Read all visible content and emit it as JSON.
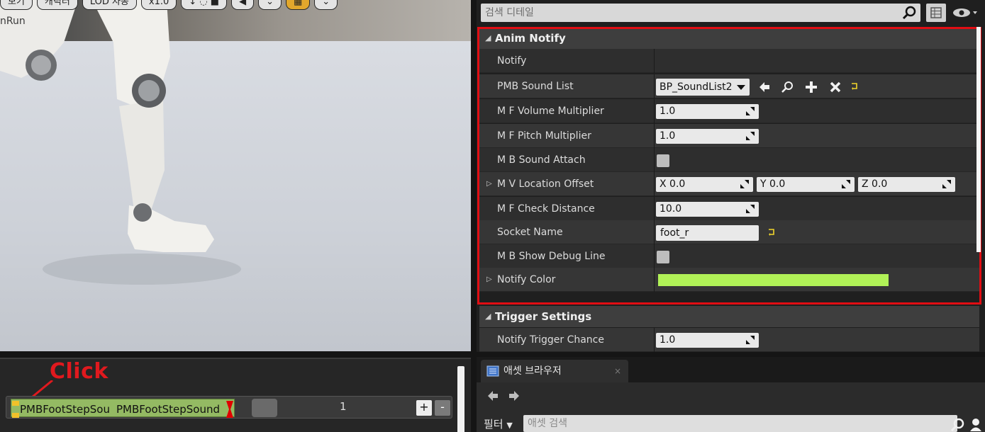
{
  "viewport": {
    "toolbar": [
      "보기",
      "캐릭터",
      "LOD 자동",
      "x1.0",
      "",
      "",
      "",
      "",
      "",
      "",
      ""
    ],
    "anim_label": "nRun"
  },
  "timeline": {
    "annotation": "Click",
    "notify_first": "PMBFootStepSou",
    "notify_second": "PMBFootStepSound",
    "track_count": "1",
    "plus_label": "+",
    "minus_label": "-"
  },
  "details": {
    "search_placeholder": "검색 디테일",
    "categories": {
      "anim_notify": "Anim Notify",
      "trigger_settings": "Trigger Settings"
    },
    "props": {
      "notify": "Notify",
      "pmb_sound_list": "PMB Sound List",
      "pmb_sound_list_value": "BP_SoundList2",
      "volume": "M F Volume Multiplier",
      "volume_value": "1.0",
      "pitch": "M F Pitch Multiplier",
      "pitch_value": "1.0",
      "sound_attach": "M B Sound Attach",
      "location_offset": "M V Location Offset",
      "loc_x": "X  0.0",
      "loc_y": "Y  0.0",
      "loc_z": "Z  0.0",
      "check_distance": "M F Check Distance",
      "check_distance_value": "10.0",
      "socket_name": "Socket Name",
      "socket_name_value": "foot_r",
      "show_debug_line": "M B Show Debug Line",
      "notify_color": "Notify Color",
      "notify_color_hex": "#b1f257",
      "trigger_chance": "Notify Trigger Chance",
      "trigger_chance_value": "1.0"
    }
  },
  "asset_browser": {
    "tab_label": "애셋 브라우저",
    "tab_close": "×",
    "filter_label": "필터",
    "search_placeholder": "애셋 검색"
  },
  "colors": {
    "highlight_box": "#e10d13",
    "notify_bar": "#94ba63",
    "click_annotation": "#e0191e"
  }
}
